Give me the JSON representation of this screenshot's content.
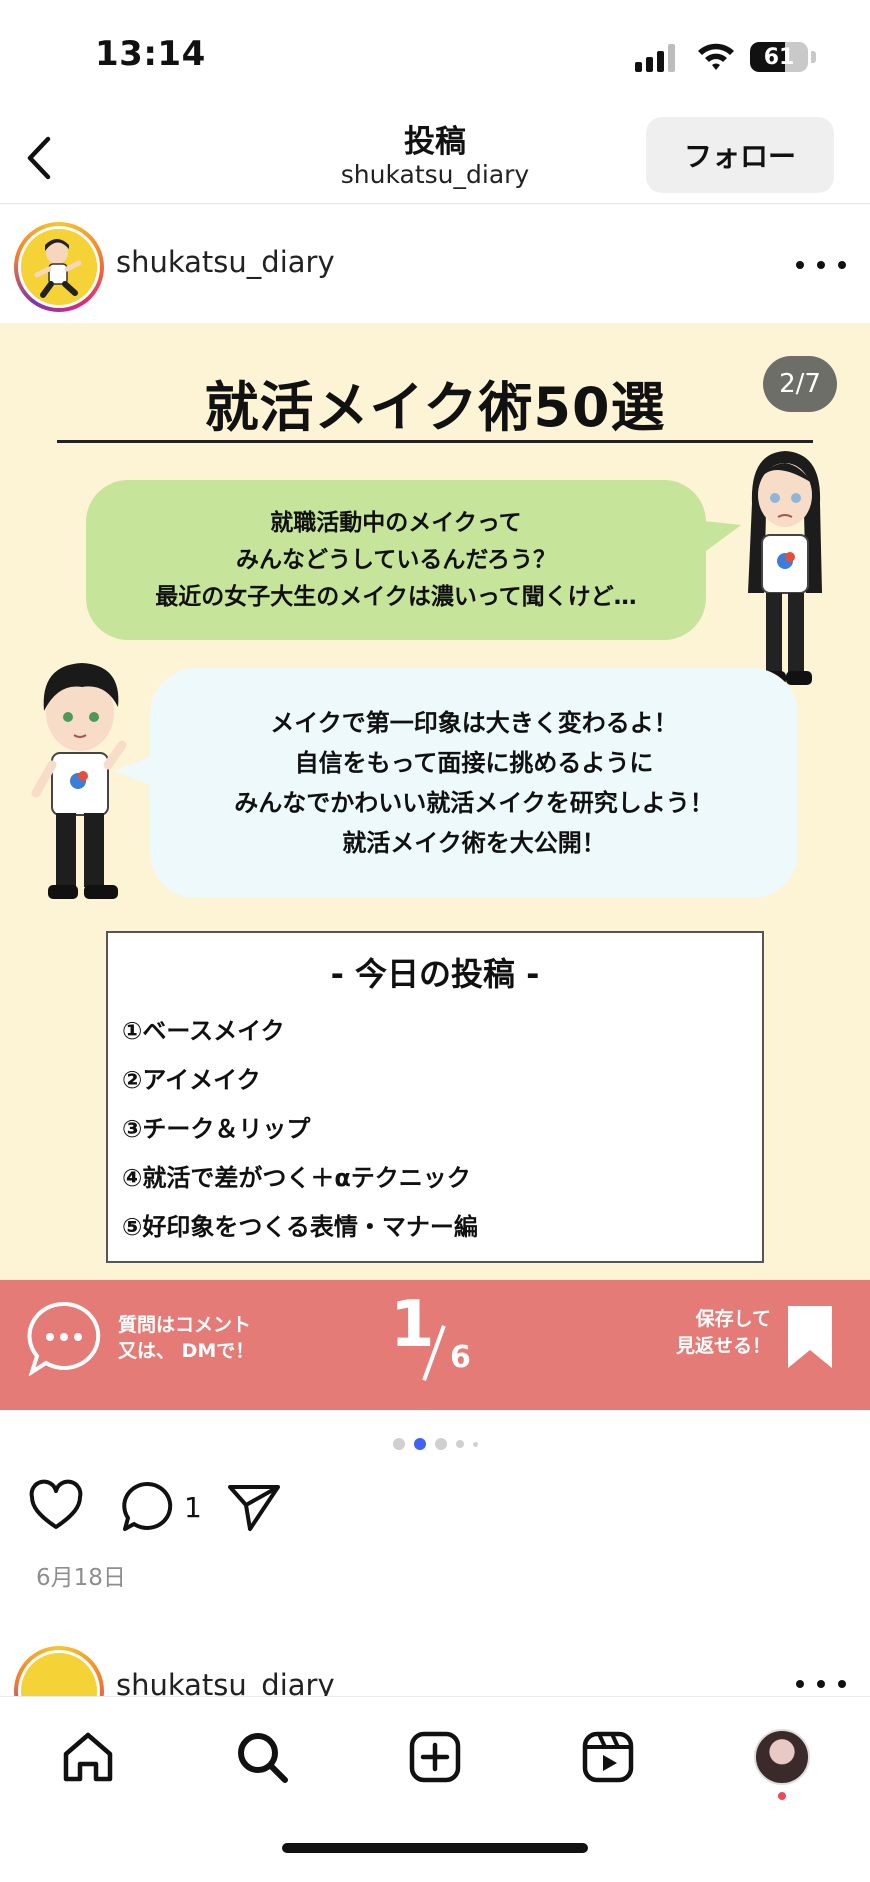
{
  "status_bar": {
    "time": "13:14",
    "battery_percent": "61",
    "battery_level": 0.61
  },
  "header": {
    "title": "投稿",
    "subtitle": "shukatsu_diary",
    "follow_label": "フォロー"
  },
  "post": {
    "username": "shukatsu_diary",
    "slide": {
      "title": "就活メイク術50選",
      "counter": "2/7",
      "bubble_girl": [
        "就職活動中のメイクって",
        "みんなどうしているんだろう？",
        "最近の女子大生のメイクは濃いって聞くけど…"
      ],
      "bubble_boy": [
        "メイクで第一印象は大きく変わるよ！",
        "自信をもって面接に挑めるように",
        "みんなでかわいい就活メイクを研究しよう！",
        "就活メイク術を大公開！"
      ],
      "topics_title": "- 今日の投稿 -",
      "topics": [
        "①ベースメイク",
        "②アイメイク",
        "③チーク＆リップ",
        "④就活で差がつく＋αテクニック",
        "⑤好印象をつくる表情・マナー編"
      ],
      "footer": {
        "left_text": [
          "質問はコメント",
          "又は、 DMで！"
        ],
        "page_current": "1",
        "page_total": "6",
        "right_text": [
          "保存して",
          "見返せる！"
        ]
      }
    },
    "carousel": {
      "count": 5,
      "active_index": 1
    },
    "comment_count": "1",
    "date": "6月18日"
  },
  "next_post": {
    "username": "shukatsu_diary"
  },
  "tabs": [
    {
      "name": "home",
      "icon": "home-icon"
    },
    {
      "name": "search",
      "icon": "search-icon"
    },
    {
      "name": "create",
      "icon": "plus-square-icon"
    },
    {
      "name": "reels",
      "icon": "reels-icon"
    },
    {
      "name": "profile",
      "icon": "avatar"
    }
  ],
  "colors": {
    "slide_bg": "#fdf4d6",
    "bubble_green": "#c7e59a",
    "bubble_blue": "#edf9fb",
    "footer_bg": "#e57b77",
    "active_dot": "#3f63f4"
  }
}
